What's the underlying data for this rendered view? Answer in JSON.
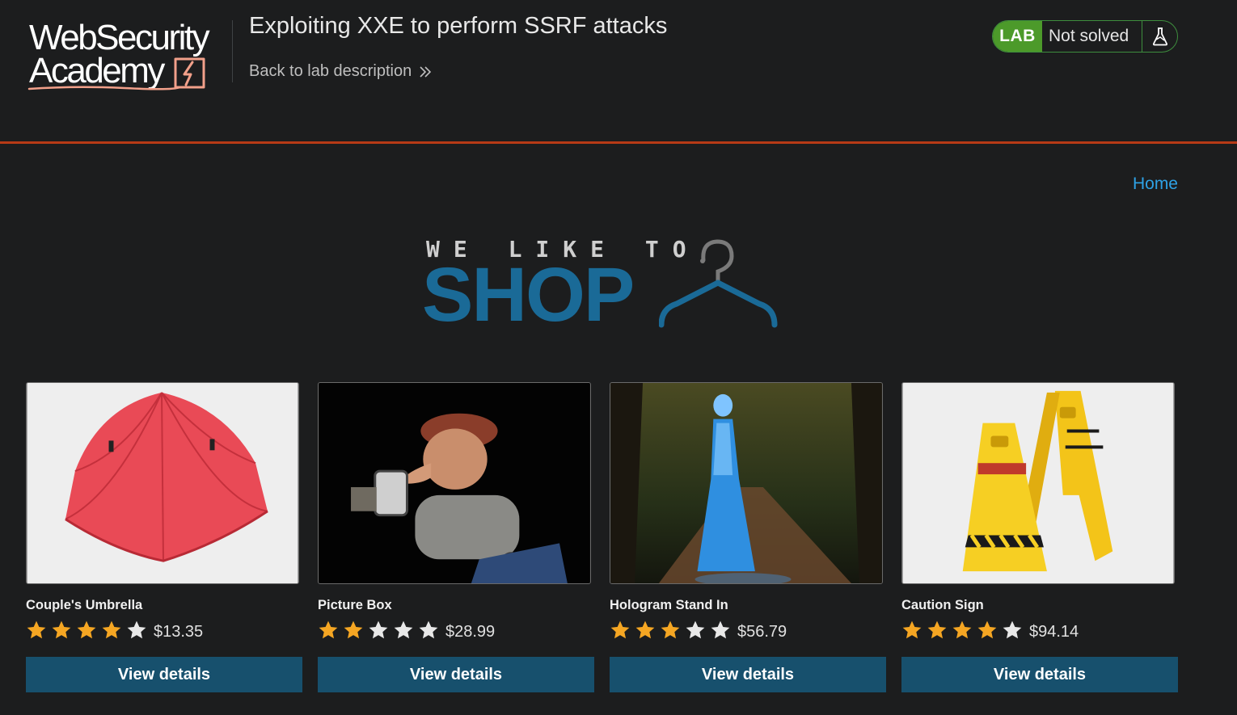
{
  "header": {
    "logo_text_line1": "WebSecurity",
    "logo_text_line2": "Academy",
    "lab_title": "Exploiting XXE to perform SSRF attacks",
    "back_link": "Back to lab description",
    "lab_badge": "LAB",
    "lab_state": "Not solved"
  },
  "nav": {
    "home": "Home"
  },
  "banner": {
    "line1": "WE LIKE TO",
    "line2": "SHOP"
  },
  "products": [
    {
      "name": "Couple's Umbrella",
      "rating": 4,
      "price": "$13.35",
      "button": "View details"
    },
    {
      "name": "Picture Box",
      "rating": 2,
      "price": "$28.99",
      "button": "View details"
    },
    {
      "name": "Hologram Stand In",
      "rating": 3,
      "price": "$56.79",
      "button": "View details"
    },
    {
      "name": "Caution Sign",
      "rating": 4,
      "price": "$94.14",
      "button": "View details"
    }
  ],
  "colors": {
    "background": "#1c1d1e",
    "header_border": "#b73a16",
    "lab_badge": "#4c9a2a",
    "link": "#2ea2e6",
    "button": "#17506d",
    "star_filled": "#f5a623",
    "star_empty": "#e8e8e8",
    "shop_blue": "#1a6a97"
  },
  "icons": {
    "back_link": "double-chevron-right-icon",
    "lab_status": "flask-icon",
    "banner": "hanger-icon",
    "rating": "star-icon"
  }
}
